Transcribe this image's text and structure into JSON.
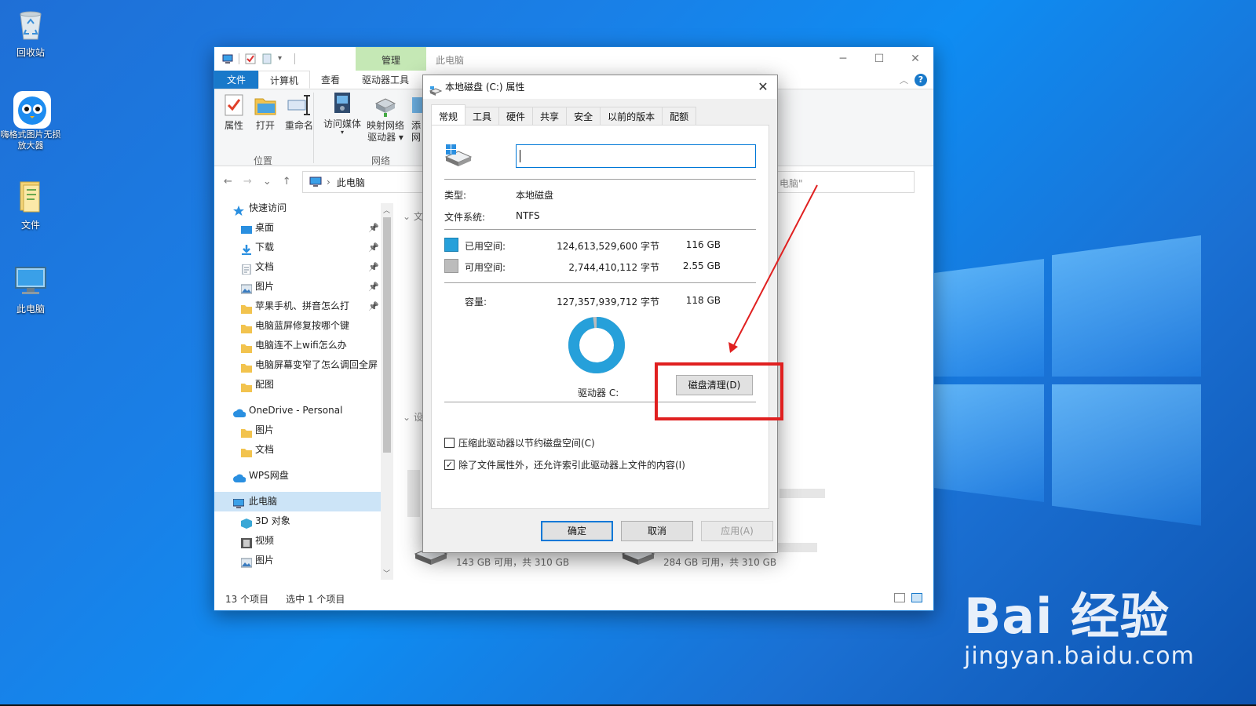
{
  "desktop": {
    "icons": [
      {
        "label": "回收站"
      },
      {
        "label": "嗨格式图片无损放大器"
      },
      {
        "label": "文件"
      },
      {
        "label": "此电脑"
      }
    ],
    "watermark": {
      "brand": "Bai 经验",
      "url": "jingyan.baidu.com"
    }
  },
  "explorer": {
    "manage_tab": "管理",
    "title": "此电脑",
    "ribbon_tabs": [
      "文件",
      "计算机",
      "查看",
      "驱动器工具"
    ],
    "ribbon_buttons": {
      "properties": "属性",
      "open": "打开",
      "rename": "重命名",
      "media": "访问媒体",
      "map_drive_1": "映射网络",
      "map_drive_2": "驱动器 ▾",
      "add_1": "添",
      "add_2": "网"
    },
    "groups": {
      "location": "位置",
      "network": "网络"
    },
    "address": "此电脑",
    "search_partial": "电脑\"",
    "sidebar": [
      {
        "label": "快速访问",
        "level": 0,
        "icon": "star"
      },
      {
        "label": "桌面",
        "icon": "desktop",
        "pinned": true
      },
      {
        "label": "下载",
        "icon": "download",
        "pinned": true
      },
      {
        "label": "文档",
        "icon": "document",
        "pinned": true
      },
      {
        "label": "图片",
        "icon": "picture",
        "pinned": true
      },
      {
        "label": "苹果手机、拼音怎么打",
        "icon": "folder",
        "pinned": true
      },
      {
        "label": "电脑蓝屏修复按哪个键",
        "icon": "folder"
      },
      {
        "label": "电脑连不上wifi怎么办",
        "icon": "folder"
      },
      {
        "label": "电脑屏幕变窄了怎么调回全屏",
        "icon": "folder"
      },
      {
        "label": "配图",
        "icon": "folder"
      },
      {
        "label": "OneDrive - Personal",
        "level": 0,
        "icon": "cloud"
      },
      {
        "label": "图片",
        "icon": "folder"
      },
      {
        "label": "文档",
        "icon": "folder"
      },
      {
        "label": "WPS网盘",
        "level": 0,
        "icon": "cloud"
      },
      {
        "label": "此电脑",
        "level": 0,
        "icon": "pc",
        "selected": true
      },
      {
        "label": "3D 对象",
        "icon": "3d"
      },
      {
        "label": "视频",
        "icon": "video"
      },
      {
        "label": "图片",
        "icon": "picture"
      }
    ],
    "section_headers": [
      "文",
      "设"
    ],
    "drives": [
      {
        "label": "143 GB 可用，共 310 GB",
        "used_fraction": 0.54
      },
      {
        "label": "284 GB 可用，共 310 GB",
        "used_fraction": 0.08
      }
    ],
    "status": {
      "items": "13 个项目",
      "selected": "选中 1 个项目"
    }
  },
  "dialog": {
    "title": "本地磁盘 (C:) 属性",
    "tabs": [
      "常规",
      "工具",
      "硬件",
      "共享",
      "安全",
      "以前的版本",
      "配额"
    ],
    "name_value": "",
    "type_label": "类型:",
    "type_value": "本地磁盘",
    "fs_label": "文件系统:",
    "fs_value": "NTFS",
    "used_label": "已用空间:",
    "used_bytes": "124,613,529,600 字节",
    "used_gb": "116 GB",
    "free_label": "可用空间:",
    "free_bytes": "2,744,410,112 字节",
    "free_gb": "2.55 GB",
    "capacity_label": "容量:",
    "capacity_bytes": "127,357,939,712 字节",
    "capacity_gb": "118 GB",
    "used_fraction": 0.978,
    "drive_label": "驱动器 C:",
    "cleanup_button": "磁盘清理(D)",
    "compress_label": "压缩此驱动器以节约磁盘空间(C)",
    "compress_checked": false,
    "index_label": "除了文件属性外，还允许索引此驱动器上文件的内容(I)",
    "index_checked": true,
    "ok": "确定",
    "cancel": "取消",
    "apply": "应用(A)",
    "colors": {
      "used": "#26a0da",
      "free": "#bcbcbc",
      "highlight": "#e02020"
    }
  }
}
